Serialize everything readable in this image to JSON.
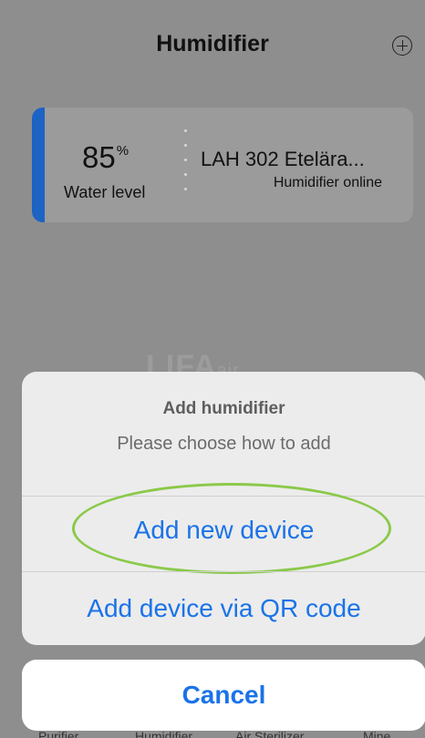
{
  "header": {
    "title": "Humidifier",
    "add_icon": "plus-circle-icon"
  },
  "device_card": {
    "accent_color": "#1c63c4",
    "water_level_value": "85",
    "water_level_unit": "%",
    "water_level_label": "Water level",
    "device_name": "LAH 302 Etelära...",
    "device_status": "Humidifier online"
  },
  "watermark": {
    "brand": "LIFA",
    "suffix": "air"
  },
  "tabbar": {
    "items": [
      "Purifier",
      "Humidifier",
      "Air Sterilizer",
      "Mine"
    ]
  },
  "action_sheet": {
    "title": "Add humidifier",
    "message": "Please choose how to add",
    "actions": [
      "Add new device",
      "Add device via QR code"
    ],
    "cancel_label": "Cancel",
    "action_color": "#1a73e8",
    "highlight_color": "#8bc94a"
  }
}
